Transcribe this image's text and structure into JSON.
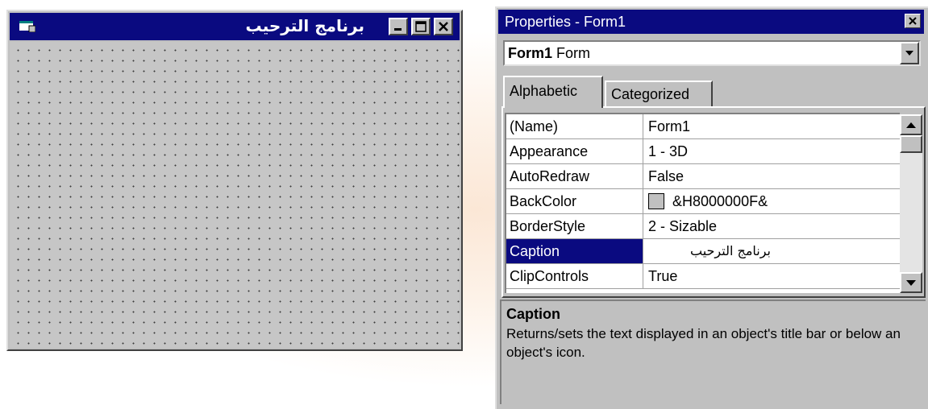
{
  "form_window": {
    "caption": "برنامج الترحيب",
    "buttons": [
      "minimize",
      "maximize",
      "close"
    ]
  },
  "properties_window": {
    "title": "Properties - Form1",
    "object_selector": {
      "name": "Form1",
      "type": "Form"
    },
    "tabs": [
      {
        "label": "Alphabetic",
        "active": true
      },
      {
        "label": "Categorized",
        "active": false
      }
    ],
    "rows": [
      {
        "name": "(Name)",
        "value": "Form1"
      },
      {
        "name": "Appearance",
        "value": "1 - 3D"
      },
      {
        "name": "AutoRedraw",
        "value": "False"
      },
      {
        "name": "BackColor",
        "value": "&H8000000F&",
        "swatch": "#c0c0c0"
      },
      {
        "name": "BorderStyle",
        "value": "2 - Sizable"
      },
      {
        "name": "Caption",
        "value": "برنامج الترحيب",
        "selected": true
      },
      {
        "name": "ClipControls",
        "value": "True"
      }
    ],
    "description": {
      "title": "Caption",
      "text": "Returns/sets the text displayed in an object's title bar or below an object's icon."
    }
  },
  "colors": {
    "titlebar": "#0a0a80",
    "face": "#c0c0c0",
    "selection": "#0a0a80"
  },
  "icons": [
    "form-icon",
    "minimize-icon",
    "maximize-icon",
    "close-icon",
    "dropdown-arrow-icon",
    "scroll-up-icon",
    "scroll-down-icon"
  ]
}
